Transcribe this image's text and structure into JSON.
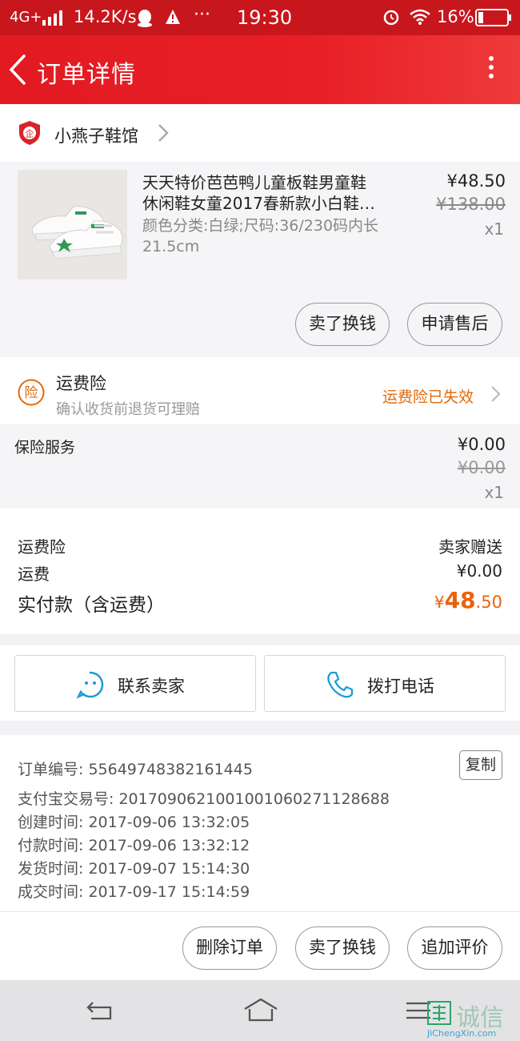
{
  "status_bar": {
    "network": "4G+",
    "speed": "14.2K/s",
    "time": "19:30",
    "battery": "16%",
    "more": "···"
  },
  "header": {
    "title": "订单详情"
  },
  "shop": {
    "name": "小燕子鞋馆",
    "badge": "企"
  },
  "product": {
    "title_line1": "天天特价芭芭鸭儿童板鞋男童鞋",
    "title_line2": "休闲鞋女童2017春新款小白鞋…",
    "spec": "颜色分类:白绿;尺码:36/230码内长21.5cm",
    "price": "¥48.50",
    "original_price": "¥138.00",
    "quantity": "x1",
    "actions": {
      "sell": "卖了换钱",
      "after_sale": "申请售后"
    }
  },
  "shipping_insurance": {
    "icon": "险",
    "title": "运费险",
    "subtitle": "确认收货前退货可理赔",
    "status": "运费险已失效"
  },
  "insurance_service": {
    "label": "保险服务",
    "price": "¥0.00",
    "original_price": "¥0.00",
    "quantity": "x1"
  },
  "summary": {
    "insurance_label": "运费险",
    "insurance_value": "卖家赠送",
    "freight_label": "运费",
    "freight_value": "¥0.00",
    "total_label": "实付款（含运费）",
    "total_currency": "¥",
    "total_int": "48",
    "total_dec": ".50"
  },
  "contact": {
    "seller": "联系卖家",
    "call": "拨打电话"
  },
  "order_info": {
    "order_no": "订单编号: 55649748382161445",
    "copy": "复制",
    "alipay_no": "支付宝交易号: 2017090621001001060271128688",
    "created": "创建时间: 2017-09-06 13:32:05",
    "paid": "付款时间: 2017-09-06 13:32:12",
    "shipped": "发货时间: 2017-09-07 15:14:30",
    "completed": "成交时间: 2017-09-17 15:14:59"
  },
  "bottom_actions": {
    "delete": "删除订单",
    "sell": "卖了换钱",
    "review": "追加评价"
  },
  "watermark": {
    "brand": "诚信",
    "site": "JiChengXin.com"
  },
  "colors": {
    "brand_red": "#e21a22",
    "status_red": "#c8161d",
    "accent_orange": "#e9620d"
  }
}
